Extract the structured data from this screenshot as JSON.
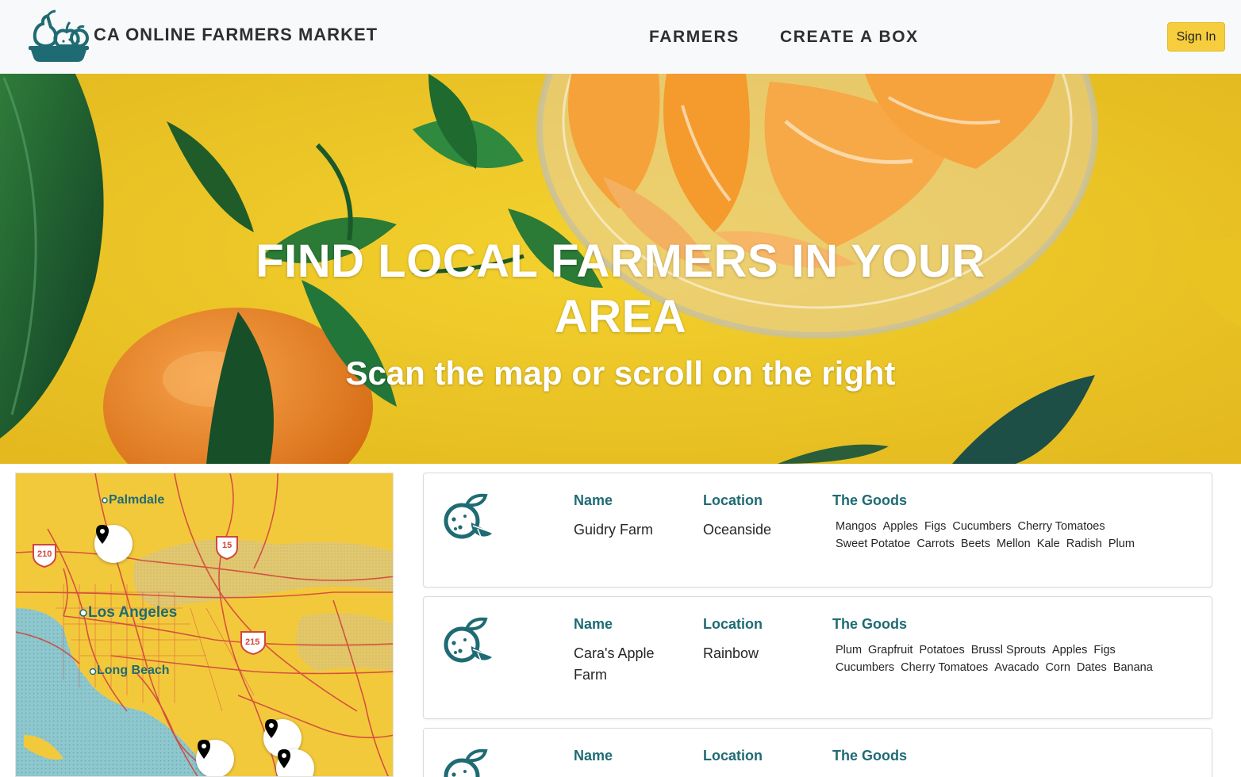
{
  "header": {
    "brand": "CA ONLINE FARMERS MARKET",
    "nav": [
      {
        "label": "FARMERS"
      },
      {
        "label": "CREATE A BOX"
      }
    ],
    "sign_in": "Sign In"
  },
  "hero": {
    "title_line1": "FIND LOCAL FARMERS IN YOUR",
    "title_line2": "AREA",
    "subtitle": "Scan the map or scroll on the right"
  },
  "map": {
    "cities": [
      "Palmdale",
      "Los Angeles",
      "Long Beach"
    ],
    "highway_shields": [
      "210",
      "15",
      "215"
    ],
    "marker_icon": "map-pin-icon"
  },
  "farmers_section": {
    "name_heading": "Name",
    "location_heading": "Location",
    "goods_heading": "The Goods",
    "card_icon": "citrus-fruit-icon",
    "farmers": [
      {
        "name": "Guidry Farm",
        "location": "Oceanside",
        "goods": [
          "Mangos",
          "Apples",
          "Figs",
          "Cucumbers",
          "Cherry Tomatoes",
          "Sweet Potatoe",
          "Carrots",
          "Beets",
          "Mellon",
          "Kale",
          "Radish",
          "Plum"
        ]
      },
      {
        "name": "Cara's Apple Farm",
        "location": "Rainbow",
        "goods": [
          "Plum",
          "Grapfruit",
          "Potatoes",
          "Brussl Sprouts",
          "Apples",
          "Figs",
          "Cucumbers",
          "Cherry Tomatoes",
          "Avacado",
          "Corn",
          "Dates",
          "Banana"
        ]
      },
      {
        "name": "",
        "location": "",
        "goods": []
      }
    ]
  },
  "colors": {
    "accent_teal": "#1f6b74",
    "sign_in_yellow": "#f6cd3d",
    "hero_yellow": "#efc92a",
    "map_road_red": "#d2463e"
  }
}
